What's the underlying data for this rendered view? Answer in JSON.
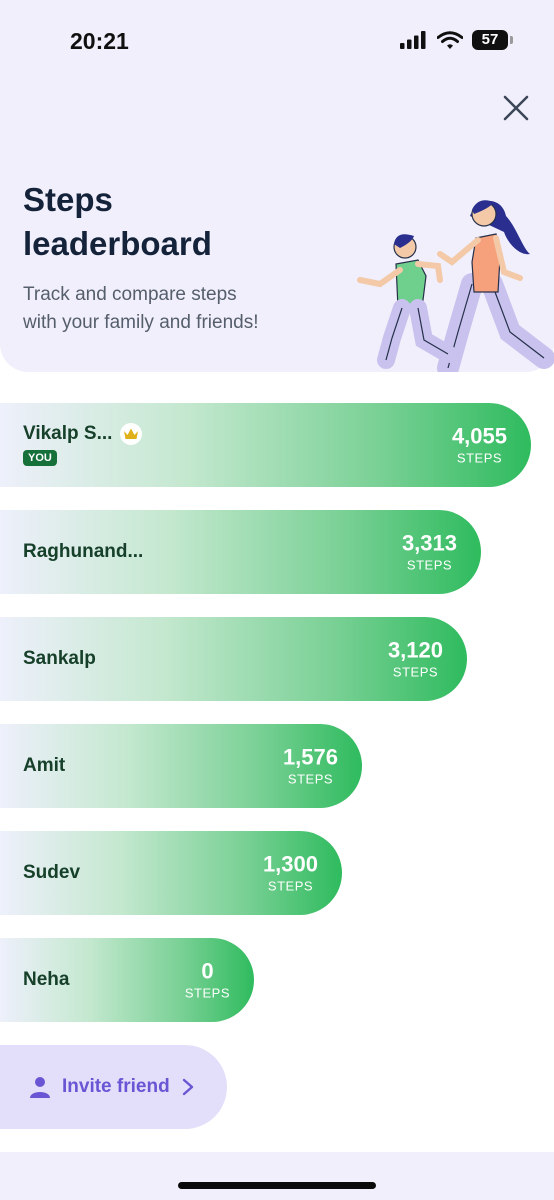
{
  "status_bar": {
    "time": "20:21",
    "battery": "57"
  },
  "header": {
    "title_line1": "Steps",
    "title_line2": "leaderboard",
    "subtitle_line1": "Track and compare steps",
    "subtitle_line2": "with your family and friends!"
  },
  "leaderboard": [
    {
      "name": "Vikalp S...",
      "badge": "YOU",
      "crown": true,
      "steps": "4,055",
      "unit": "STEPS"
    },
    {
      "name": "Raghunand...",
      "steps": "3,313",
      "unit": "STEPS"
    },
    {
      "name": "Sankalp",
      "steps": "3,120",
      "unit": "STEPS"
    },
    {
      "name": "Amit",
      "steps": "1,576",
      "unit": "STEPS"
    },
    {
      "name": "Sudev",
      "steps": "1,300",
      "unit": "STEPS"
    },
    {
      "name": "Neha",
      "steps": "0",
      "unit": "STEPS"
    }
  ],
  "invite": {
    "label": "Invite friend"
  },
  "colors": {
    "accent": "#2fbb5e",
    "name_text": "#16402a",
    "invite": "#6a55d4",
    "header_bg": "#f1effb"
  }
}
